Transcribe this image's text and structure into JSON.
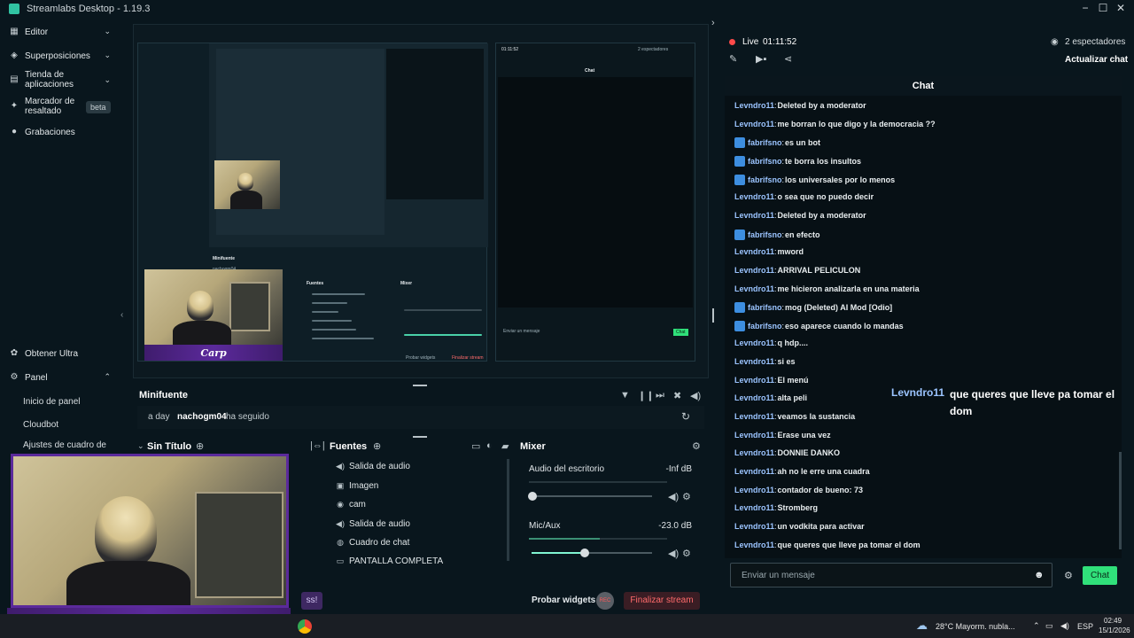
{
  "window": {
    "title": "Streamlabs Desktop - 1.19.3",
    "min": "−",
    "max": "☐",
    "close": "✕"
  },
  "sidebar": {
    "items": [
      {
        "label": "Editor",
        "icon": "grid-icon"
      },
      {
        "label": "Superposiciones",
        "icon": "layers-icon"
      },
      {
        "label": "Tienda de aplicaciones",
        "icon": "store-icon"
      },
      {
        "label": "Marcador de resaltado",
        "icon": "highlight-icon",
        "badge": "beta"
      },
      {
        "label": "Grabaciones",
        "icon": "record-icon"
      }
    ],
    "bottom": [
      {
        "label": "Obtener Ultra",
        "icon": "ultra-icon"
      },
      {
        "label": "Panel",
        "icon": "panel-icon"
      }
    ],
    "sub": [
      "Inicio de panel",
      "Cloudbot",
      "Ajustes de cuadro de"
    ]
  },
  "minifuente": {
    "title": "Minifuente",
    "time": "a day",
    "user": "nachogm04",
    "action": "ha seguido"
  },
  "scenes": {
    "title": "Sin Título"
  },
  "sources": {
    "title": "Fuentes",
    "items": [
      {
        "label": "Salida de audio",
        "icon": "speaker-icon"
      },
      {
        "label": "Imagen",
        "icon": "image-icon"
      },
      {
        "label": "cam",
        "icon": "camera-icon"
      },
      {
        "label": "Salida de audio",
        "icon": "speaker-icon"
      },
      {
        "label": "Cuadro de chat",
        "icon": "chat-icon"
      },
      {
        "label": "PANTALLA COMPLETA",
        "icon": "monitor-icon"
      }
    ]
  },
  "mixer": {
    "title": "Mixer",
    "channels": [
      {
        "label": "Audio del escritorio",
        "value": "-Inf dB",
        "level": 0.0
      },
      {
        "label": "Mic/Aux",
        "value": "-23.0 dB",
        "level": 0.45
      }
    ]
  },
  "footer": {
    "test_widgets": "Probar widgets",
    "rec": "REC",
    "end_stream": "Finalizar stream",
    "partial_button": "ss!"
  },
  "cam_overlay": {
    "logo_text": "Carp"
  },
  "stream": {
    "status": "Live",
    "time": "01:11:52",
    "viewers": "2 espectadores",
    "update_chat": "Actualizar chat"
  },
  "chat": {
    "title": "Chat",
    "messages": [
      {
        "user": "Levndro11",
        "text": "Deleted by a moderator",
        "plat": false
      },
      {
        "user": "Levndro11",
        "text": "me borran lo que digo y la democracia ??",
        "plat": false
      },
      {
        "user": "fabrifsno",
        "text": "es un bot",
        "plat": true
      },
      {
        "user": "fabrifsno",
        "text": "te borra los insultos",
        "plat": true
      },
      {
        "user": "fabrifsno",
        "text": "los universales por lo menos",
        "plat": true
      },
      {
        "user": "Levndro11",
        "text": "o sea que no puedo decir",
        "plat": false
      },
      {
        "user": "Levndro11",
        "text": "Deleted by a moderator",
        "plat": false
      },
      {
        "user": "fabrifsno",
        "text": "en efecto",
        "plat": true
      },
      {
        "user": "Levndro11",
        "text": "mword",
        "plat": false
      },
      {
        "user": "Levndro11",
        "text": "ARRIVAL PELICULON",
        "plat": false
      },
      {
        "user": "Levndro11",
        "text": "me hicieron analizarla en una materia",
        "plat": false
      },
      {
        "user": "fabrifsno",
        "text": "mog (Deleted) AI Mod [Odio]",
        "plat": true
      },
      {
        "user": "fabrifsno",
        "text": "eso aparece cuando lo mandas",
        "plat": true
      },
      {
        "user": "Levndro11",
        "text": "q hdp....",
        "plat": false
      },
      {
        "user": "Levndro11",
        "text": "si es",
        "plat": false
      },
      {
        "user": "Levndro11",
        "text": "El menú",
        "plat": false
      },
      {
        "user": "Levndro11",
        "text": "alta peli",
        "plat": false
      },
      {
        "user": "Levndro11",
        "text": "veamos la sustancia",
        "plat": false
      },
      {
        "user": "Levndro11",
        "text": "Erase una vez",
        "plat": false
      },
      {
        "user": "Levndro11",
        "text": "DONNIE DANKO",
        "plat": false
      },
      {
        "user": "Levndro11",
        "text": "ah no le erre una cuadra",
        "plat": false
      },
      {
        "user": "Levndro11",
        "text": "contador de bueno: 73",
        "plat": false
      },
      {
        "user": "Levndro11",
        "text": "Stromberg",
        "plat": false
      },
      {
        "user": "Levndro11",
        "text": "un vodkita para activar",
        "plat": false
      },
      {
        "user": "Levndro11",
        "text": "que queres que lleve pa tomar el dom",
        "plat": false
      }
    ],
    "input_placeholder": "Enviar un mensaje",
    "send": "Chat"
  },
  "overlay": {
    "user": "Levndro11",
    "text": "que queres que lleve pa tomar el dom"
  },
  "taskbar": {
    "weather": "28°C  Mayorm. nubla...",
    "lang": "ESP",
    "time": "02:49",
    "date": "15/1/2026"
  }
}
